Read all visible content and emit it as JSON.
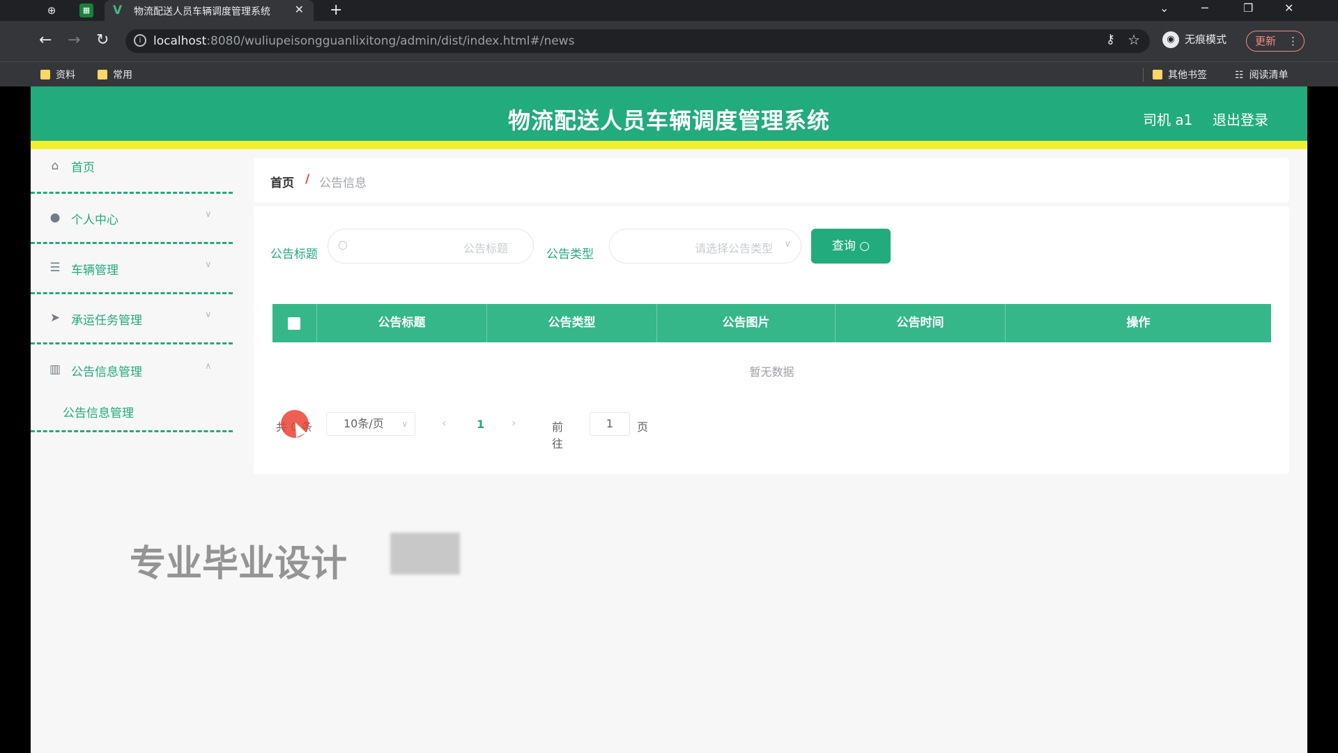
{
  "browser": {
    "tab_title": "物流配送人员车辆调度管理系统",
    "url_host": "localhost",
    "url_rest": ":8080/wuliupeisongguanlixitong/admin/dist/index.html#/news",
    "incognito_label": "无痕模式",
    "update_label": "更新",
    "bookmarks": [
      {
        "label": "资料"
      },
      {
        "label": "常用"
      },
      {
        "label": "其他书签"
      },
      {
        "label": "阅读清单"
      }
    ]
  },
  "app": {
    "title": "物流配送人员车辆调度管理系统",
    "user": "司机 a1",
    "logout": "退出登录"
  },
  "sidebar": {
    "items": [
      {
        "label": "首页",
        "icon": "home-icon"
      },
      {
        "label": "个人中心",
        "icon": "user-icon"
      },
      {
        "label": "车辆管理",
        "icon": "list-icon"
      },
      {
        "label": "承运任务管理",
        "icon": "send-icon"
      },
      {
        "label": "公告信息管理",
        "icon": "chart-icon"
      }
    ],
    "submenu": [
      {
        "label": "公告信息管理"
      }
    ]
  },
  "breadcrumb": {
    "home": "首页",
    "separator": "/",
    "current": "公告信息"
  },
  "search": {
    "title_label": "公告标题",
    "title_placeholder": "公告标题",
    "type_label": "公告类型",
    "type_placeholder": "请选择公告类型",
    "query_label": "查询"
  },
  "table": {
    "columns": [
      "公告标题",
      "公告类型",
      "公告图片",
      "公告时间",
      "操作"
    ],
    "empty_text": "暂无数据"
  },
  "pagination": {
    "total_text": "共 0 条",
    "page_size": "10条/页",
    "current_page": "1",
    "goto_label": "前往",
    "goto_value": "1",
    "page_unit": "页"
  },
  "watermark": {
    "text": "专业毕业设计"
  },
  "colors": {
    "primary": "#22ab7d",
    "accent_yellow": "#f2ef2e"
  }
}
